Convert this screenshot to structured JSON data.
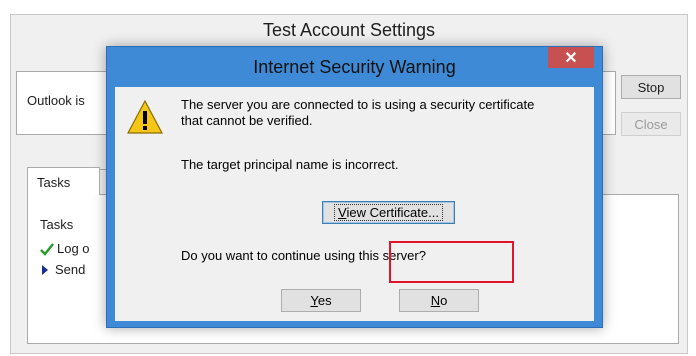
{
  "background_window": {
    "title": "Test Account Settings",
    "status_text": "Outlook is",
    "stop_label": "Stop",
    "close_label": "Close",
    "tab_label": "Tasks",
    "tasks_header": "Tasks",
    "task1": "Log o",
    "task2": "Send"
  },
  "dialog": {
    "title": "Internet Security Warning",
    "close_symbol": "✕",
    "message_line1": "The server you are connected to is using a security certificate",
    "message_line2": "that cannot be verified.",
    "message_detail": "The target principal name is incorrect.",
    "view_certificate_first": "V",
    "view_certificate_rest": "iew Certificate...",
    "question": "Do you want to continue using this server?",
    "yes_first": "Y",
    "yes_rest": "es",
    "no_first": "N",
    "no_rest": "o",
    "icon": "warning-triangle-icon"
  },
  "colors": {
    "dialog_frame": "#3e8ad6",
    "close_button": "#c75050",
    "highlight": "#e0142a"
  }
}
